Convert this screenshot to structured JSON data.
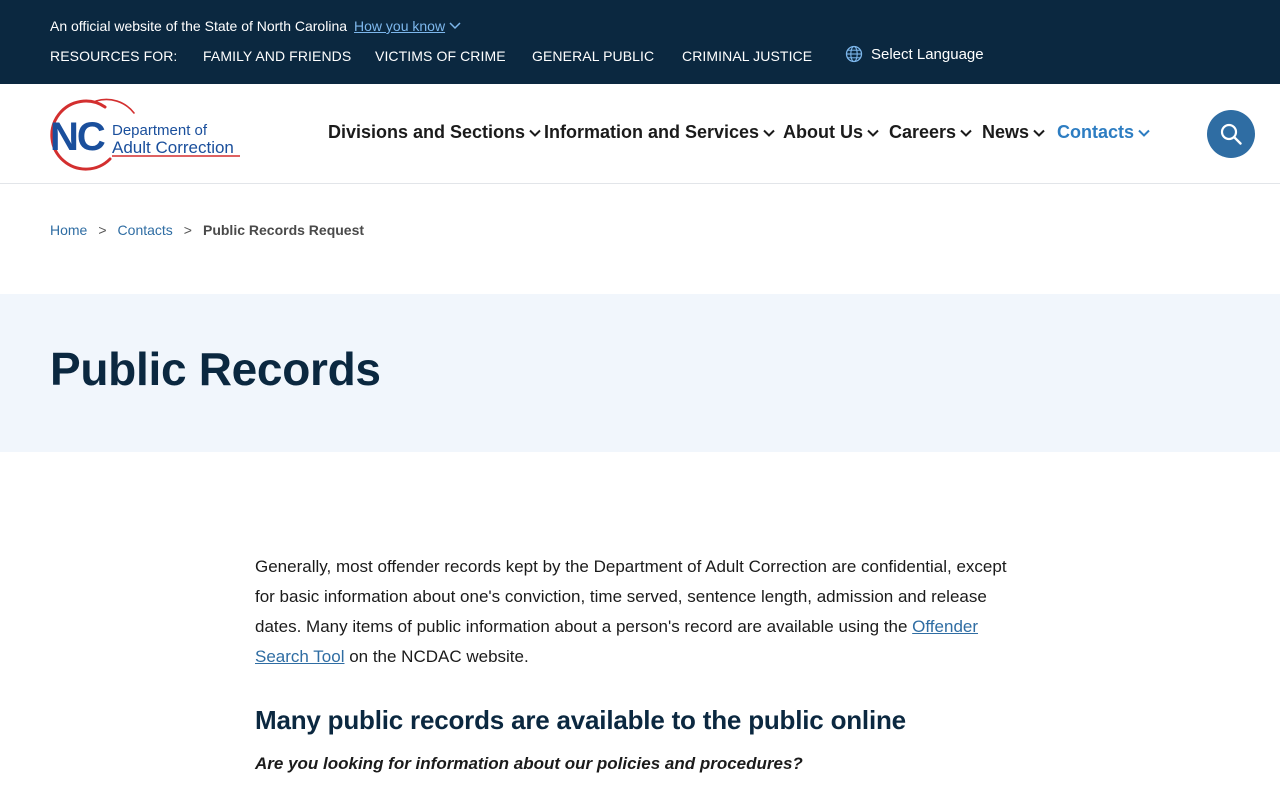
{
  "utility_bar": {
    "official_text": "An official website of the State of North Carolina",
    "how_you_know": "How you know",
    "resources_label": "RESOURCES FOR:",
    "resource_links": [
      "FAMILY AND FRIENDS",
      "VICTIMS OF CRIME",
      "GENERAL PUBLIC",
      "CRIMINAL JUSTICE"
    ],
    "language": "Select Language"
  },
  "logo": {
    "abbr": "NC",
    "line1": "Department of",
    "line2": "Adult Correction"
  },
  "nav": {
    "items": [
      {
        "label": "Divisions and Sections",
        "active": false
      },
      {
        "label": "Information and Services",
        "active": false
      },
      {
        "label": "About Us",
        "active": false
      },
      {
        "label": "Careers",
        "active": false
      },
      {
        "label": "News",
        "active": false
      },
      {
        "label": "Contacts",
        "active": true
      }
    ]
  },
  "breadcrumb": {
    "items": [
      "Home",
      "Contacts"
    ],
    "separator": ">",
    "current": "Public Records Request"
  },
  "page_title": "Public Records",
  "content": {
    "intro_before_link": "Generally, most offender records kept by the Department of Adult Correction are confidential, except for basic information about one's conviction, time served, sentence length, admission and release dates. Many items of public information about a person's record are available using the ",
    "intro_link": "Offender Search Tool",
    "intro_after_link": " on the NCDAC website.",
    "heading": "Many public records are available to the public online",
    "question": "Are you looking for information about our policies and procedures?"
  },
  "colors": {
    "utility_bg": "#0b2840",
    "link_blue": "#2f6da3",
    "active_nav": "#2d7dc2",
    "hero_bg": "#f1f6fc",
    "logo_red": "#d32f2f",
    "logo_navy": "#1a4f9c"
  },
  "icons": {
    "how_you_know": "chevron-down-icon",
    "language": "globe-icon",
    "nav_dropdown": "chevron-down-icon",
    "search": "search-icon"
  }
}
